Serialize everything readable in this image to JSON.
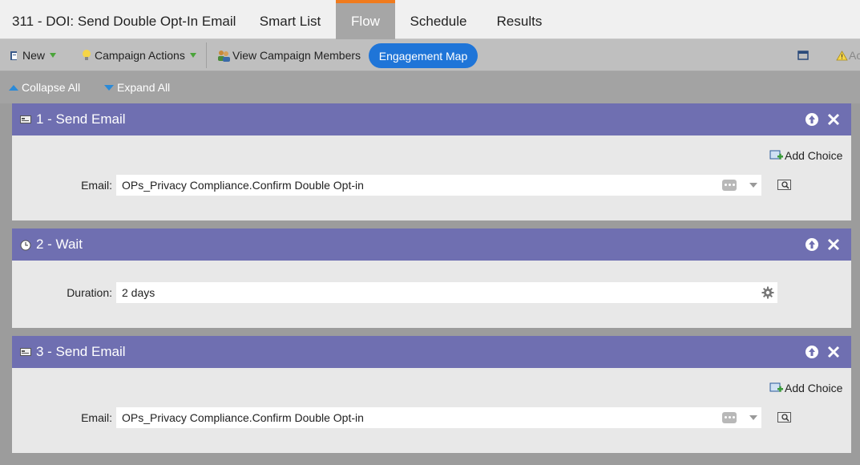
{
  "campaign_title": "311 - DOI: Send Double Opt-In Email",
  "tabs": [
    {
      "label": "Smart List",
      "active": false
    },
    {
      "label": "Flow",
      "active": true
    },
    {
      "label": "Schedule",
      "active": false
    },
    {
      "label": "Results",
      "active": false
    }
  ],
  "toolbar": {
    "new_label": "New",
    "campaign_actions_label": "Campaign Actions",
    "view_members_label": "View Campaign Members",
    "engagement_map_label": "Engagement Map",
    "truncated_right_label": "Ac"
  },
  "subbar": {
    "collapse_all": "Collapse All",
    "expand_all": "Expand All"
  },
  "steps": [
    {
      "title": "1 - Send Email",
      "icon": "email-icon",
      "add_choice_label": "Add Choice",
      "field_label": "Email:",
      "field_value": "OPs_Privacy Compliance.Confirm Double Opt-in"
    },
    {
      "title": "2 - Wait",
      "icon": "clock-icon",
      "field_label": "Duration:",
      "field_value": "2 days"
    },
    {
      "title": "3 - Send Email",
      "icon": "email-icon",
      "add_choice_label": "Add Choice",
      "field_label": "Email:",
      "field_value": "OPs_Privacy Compliance.Confirm Double Opt-in"
    }
  ],
  "colors": {
    "step_header": "#6f6fb1",
    "active_tab_accent": "#f07b1d",
    "engagement_button": "#1f75d8"
  }
}
